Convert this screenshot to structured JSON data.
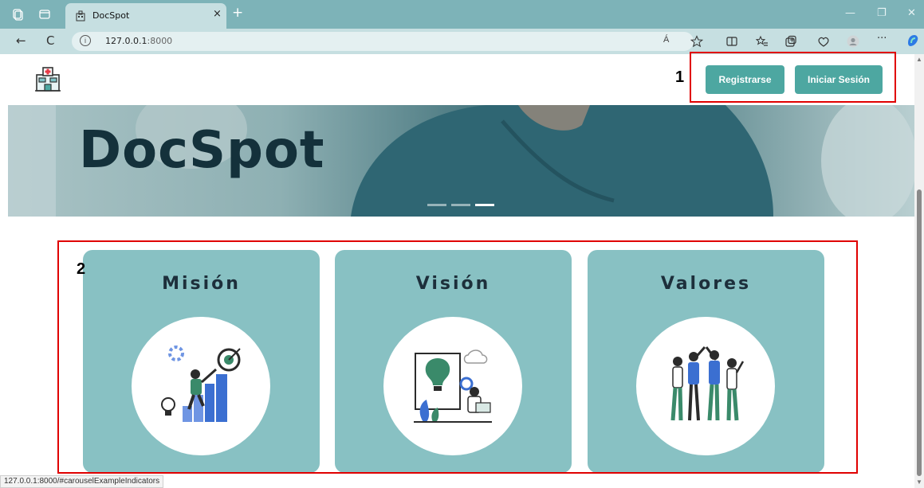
{
  "browser": {
    "tab_title": "DocSpot",
    "tab_close": "×",
    "new_tab": "+",
    "url_host": "127.0.0.1",
    "url_port": ":8000",
    "read_aloud": "Á",
    "more": "···",
    "window_min": "—",
    "window_max": "❐",
    "window_close": "✕",
    "back": "←",
    "refresh": "C",
    "info": "i"
  },
  "header": {
    "register_label": "Registrarse",
    "login_label": "Iniciar Sesión"
  },
  "hero": {
    "title": "DocSpot",
    "slides": 3,
    "active_slide": 3
  },
  "cards": [
    {
      "title": "Misión",
      "icon": "growth-goal-illustration"
    },
    {
      "title": "Visión",
      "icon": "idea-vision-illustration"
    },
    {
      "title": "Valores",
      "icon": "team-values-illustration"
    }
  ],
  "annotations": {
    "one": "1",
    "two": "2"
  },
  "status_url": "127.0.0.1:8000/#carouselExampleIndicators",
  "colors": {
    "accent": "#4da7a1",
    "card": "#88c1c3",
    "annotation": "#e00000"
  }
}
